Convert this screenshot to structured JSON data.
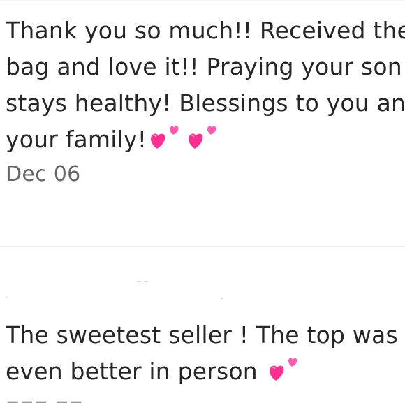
{
  "reviews": [
    {
      "lines": [
        "Thank you so much!! Received the",
        "bag and love it!! Praying your son",
        "stays healthy! Blessings to you and",
        "your family!"
      ],
      "date": "Dec 06",
      "emoji_count": 2
    },
    {
      "lines": [
        "The sweetest seller ! The top was",
        "even better in person"
      ],
      "emoji_count": 1
    }
  ],
  "icons": {
    "emoji": "two-hearts-icon"
  },
  "colors": {
    "text": "#262626",
    "date": "#666666",
    "heart_primary": "#ff2f8f",
    "heart_secondary": "#ff5ab0",
    "divider": "#ececec"
  }
}
